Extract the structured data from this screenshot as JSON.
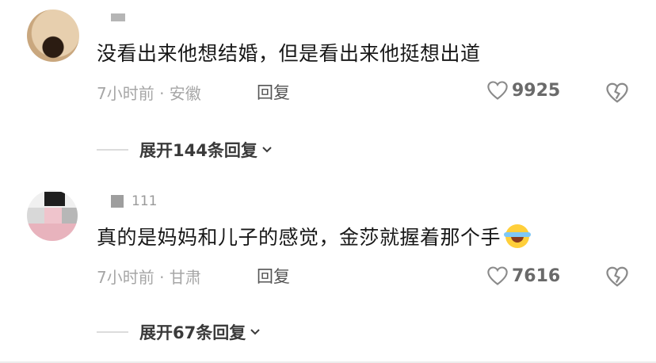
{
  "comments": [
    {
      "username_tag": "",
      "text": "没看出来他想结婚，但是看出来他挺想出道",
      "meta": "7小时前 · 安徽",
      "reply_label": "回复",
      "likes": "9925",
      "expand_label": "展开144条回复"
    },
    {
      "username_tag": "111",
      "text": "真的是妈妈和儿子的感觉，金莎就握着那个手",
      "emoji": "laughing-tears-emoji",
      "meta": "7小时前 · 甘肃",
      "reply_label": "回复",
      "likes": "7616",
      "expand_label": "展开67条回复"
    }
  ],
  "colors": {
    "text": "#181818",
    "meta": "#a6a6a6",
    "icon": "#8a8a8a"
  },
  "icons": {
    "like": "heart-icon",
    "dislike": "broken-heart-icon",
    "expand": "chevron-down-icon"
  }
}
